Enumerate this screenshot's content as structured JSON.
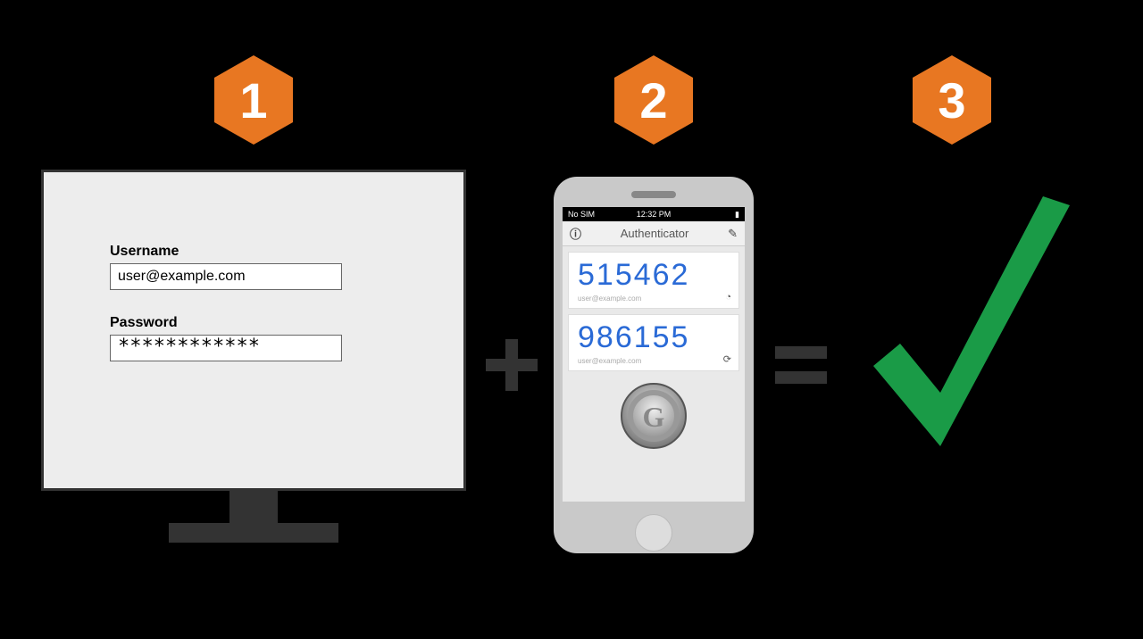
{
  "badges": {
    "one": "1",
    "two": "2",
    "three": "3"
  },
  "colors": {
    "hex": "#e87722",
    "check": "#1a9b47",
    "op": "#333333"
  },
  "login": {
    "username_label": "Username",
    "username_value": "user@example.com",
    "password_label": "Password",
    "password_value": "************"
  },
  "phone": {
    "carrier": "No SIM",
    "time": "12:32 PM",
    "app_title": "Authenticator",
    "codes": [
      {
        "code": "515462",
        "account": "user@example.com"
      },
      {
        "code": "986155",
        "account": "user@example.com"
      }
    ]
  },
  "operators": {
    "plus": "+",
    "equals": "="
  }
}
